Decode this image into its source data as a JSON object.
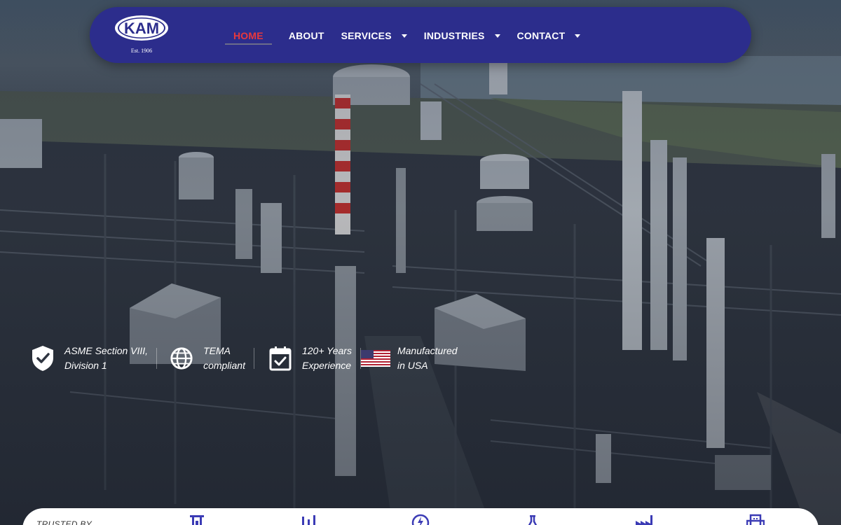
{
  "brand": {
    "logo_text": "KAM",
    "established": "Est. 1906"
  },
  "nav": {
    "items": [
      {
        "label": "HOME",
        "active": true,
        "has_dropdown": false
      },
      {
        "label": "ABOUT",
        "active": false,
        "has_dropdown": false
      },
      {
        "label": "SERVICES",
        "active": false,
        "has_dropdown": true
      },
      {
        "label": "INDUSTRIES",
        "active": false,
        "has_dropdown": true
      },
      {
        "label": "CONTACT",
        "active": false,
        "has_dropdown": true
      }
    ]
  },
  "features": [
    {
      "icon": "shield-check-icon",
      "line1": "ASME Section VIII,",
      "line2": "Division 1"
    },
    {
      "icon": "globe-icon",
      "line1": "TEMA",
      "line2": "compliant"
    },
    {
      "icon": "calendar-check-icon",
      "line1": "120+ Years",
      "line2": "Experience"
    },
    {
      "icon": "us-flag-icon",
      "line1": "Manufactured",
      "line2": "in USA"
    }
  ],
  "trusted": {
    "label": "TRUSTED BY",
    "icons": [
      "refinery-icon",
      "chemical-plant-icon",
      "power-icon",
      "lab-flask-icon",
      "factory-icon",
      "building-icon"
    ]
  },
  "colors": {
    "nav_bg": "#2c2d8c",
    "active": "#e8383d",
    "icon_accent": "#3b3bb5"
  }
}
